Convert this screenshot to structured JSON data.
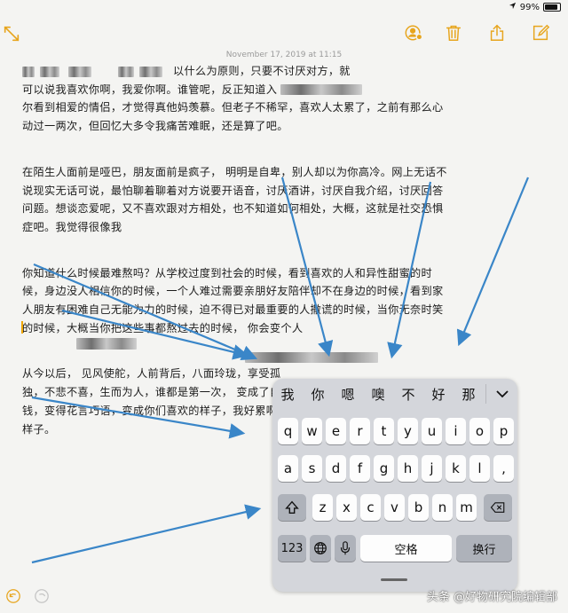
{
  "status": {
    "battery": "99%",
    "battery_level": 0.99
  },
  "toolbar": {
    "icons": [
      "collapse-arrows-icon",
      "collaborate-icon",
      "trash-icon",
      "share-icon",
      "compose-icon"
    ],
    "accent_color": "#e7a51d"
  },
  "note": {
    "date": "November 17, 2019 at 11:15",
    "paragraphs": [
      [
        "以什么为原则，只要不讨厌对方，就",
        "可以说我喜欢你啊，我爱你啊。谁管呢，反正知道入",
        "尔看到相爱的情侣，才觉得真他妈羡慕。但老子不稀罕，喜欢人太累了，之前有那么心",
        "动过一两次，但回忆大多令我痛苦难眠，还是算了吧。"
      ],
      [
        "在陌生人面前是哑巴，朋友面前是疯子，  明明是自卑，别人却以为你高冷。网上无话不",
        "说现实无话可说，最怕聊着聊着对方说要开语音，讨厌酒讲，讨厌自我介绍，讨厌回答",
        "问题。想谈恋爱呢，又不喜欢跟对方相处，也不知道如何相处，大概，这就是社交恐惧",
        "症吧。我觉得很像我"
      ],
      [
        "你知道什么时候最难熬吗？从学校过度到社会的时候，看到喜欢的人和异性甜蜜的时",
        "候，身边没人相信你的时候，一个人难过需要亲朋好友陪伴却不在身边的时候，看到家",
        "人朋友有困难自己无能为力的时候，迫不得已对最重要的人撒谎的时候，当你无奈时笑",
        "的时候，大概当你把这些事都熬过去的时候，  你会变个人"
      ],
      [
        "从今以后，          见风使舵，人前背后，八面玲珑，享受孤",
        "独，不悲不喜，生而为人，谁都是第一次，          变成了自己当初最讨厌的",
        "钱，变得花言巧语，变成你们喜欢的样子，我好累啊，我终于变成了自己当初最讨厌的",
        "样子。"
      ]
    ]
  },
  "keyboard": {
    "candidates": [
      "我",
      "你",
      "嗯",
      "噢",
      "不",
      "好",
      "那"
    ],
    "row1": [
      "q",
      "w",
      "e",
      "r",
      "t",
      "y",
      "u",
      "i",
      "o",
      "p"
    ],
    "row2": [
      "a",
      "s",
      "d",
      "f",
      "g",
      "h",
      "j",
      "k",
      "l"
    ],
    "row3": [
      "z",
      "x",
      "c",
      "v",
      "b",
      "n",
      "m"
    ],
    "numbers_key": "123",
    "space_key": "空格",
    "return_key": "换行"
  },
  "watermark": "头条 @好物研究院编辑部"
}
